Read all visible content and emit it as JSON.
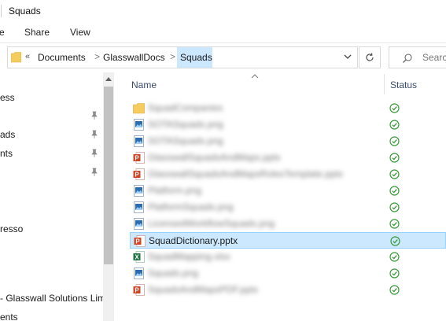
{
  "window": {
    "title": "Squads"
  },
  "ribbon": {
    "tabs": [
      {
        "label": "e"
      },
      {
        "label": "Share"
      },
      {
        "label": "View"
      }
    ]
  },
  "address": {
    "overflow_chevron": "«",
    "crumbs": [
      {
        "label": "Documents"
      },
      {
        "label": "GlasswallDocs"
      },
      {
        "label": "Squads"
      }
    ],
    "separator": ">"
  },
  "search": {
    "placeholder": "Searc"
  },
  "nav": {
    "items": [
      {
        "label": "ess",
        "pinned": false
      },
      {
        "label": "ads",
        "pinned": true
      },
      {
        "label": "nts",
        "pinned": true
      },
      {
        "label": "resso",
        "pinned": false
      },
      {
        "label": "- Glasswall Solutions Lim",
        "pinned": false
      },
      {
        "label": "ents",
        "pinned": false
      }
    ]
  },
  "files": {
    "columns": {
      "name": "Name",
      "status": "Status"
    },
    "sort": "name-ascending",
    "rows": [
      {
        "name": "SquadCompanies",
        "icon": "folder-icon",
        "blurred": true,
        "selected": false,
        "status": "synced-icon"
      },
      {
        "name": "SOTASquads.png",
        "icon": "image-file-icon",
        "blurred": true,
        "selected": false,
        "status": "synced-icon"
      },
      {
        "name": "SOTASquads.png",
        "icon": "image-file-icon",
        "blurred": true,
        "selected": false,
        "status": "synced-icon"
      },
      {
        "name": "GlasswallSquadsAndMaps.pptx",
        "icon": "powerpoint-file-icon",
        "blurred": true,
        "selected": false,
        "status": "synced-icon"
      },
      {
        "name": "GlasswallSquadsAndMapsRolesTemplate.pptx",
        "icon": "powerpoint-file-icon",
        "blurred": true,
        "selected": false,
        "status": "synced-icon"
      },
      {
        "name": "Platform.png",
        "icon": "image-file-icon",
        "blurred": true,
        "selected": false,
        "status": "synced-icon"
      },
      {
        "name": "PlatformSquads.png",
        "icon": "image-file-icon",
        "blurred": true,
        "selected": false,
        "status": "synced-icon"
      },
      {
        "name": "LicensedWorkflowSquads.png",
        "icon": "image-file-icon",
        "blurred": true,
        "selected": false,
        "status": "synced-icon"
      },
      {
        "name": "SquadDictionary.pptx",
        "icon": "powerpoint-file-icon",
        "blurred": false,
        "selected": true,
        "status": "synced-icon"
      },
      {
        "name": "SquadMapping.xlsx",
        "icon": "excel-file-icon",
        "blurred": true,
        "selected": false,
        "status": "synced-icon"
      },
      {
        "name": "Squads.png",
        "icon": "image-file-icon",
        "blurred": true,
        "selected": false,
        "status": "synced-icon"
      },
      {
        "name": "SquadsAndMapsPDF.pptx",
        "icon": "powerpoint-file-icon",
        "blurred": true,
        "selected": false,
        "status": "synced-icon"
      }
    ]
  },
  "colors": {
    "selection": "#cce8ff",
    "selection_border": "#99d1ff",
    "header_text": "#3b4b6b",
    "sync_green": "#3a9a3a",
    "folder_yellow": "#f5cd5e",
    "powerpoint_red": "#d04423",
    "excel_green": "#1f7244",
    "image_blue": "#2b6cb0"
  }
}
